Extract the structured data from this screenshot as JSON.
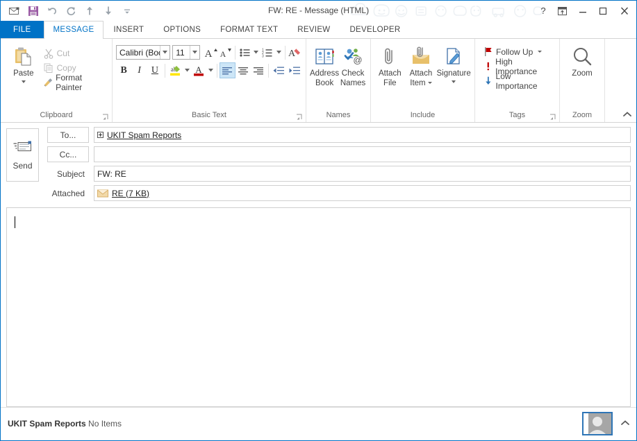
{
  "window": {
    "title": "FW: RE - Message (HTML)",
    "accent_color": "#0072c6",
    "quick_access": [
      {
        "name": "message-icon",
        "label": "Message"
      },
      {
        "name": "save-icon",
        "label": "Save"
      },
      {
        "name": "undo-icon",
        "label": "Undo"
      },
      {
        "name": "redo-icon",
        "label": "Redo"
      },
      {
        "name": "previous-item-icon",
        "label": "Previous Item"
      },
      {
        "name": "next-item-icon",
        "label": "Next Item"
      },
      {
        "name": "customize-qat-icon",
        "label": "Customize Quick Access Toolbar"
      }
    ],
    "controls": {
      "help": "?",
      "ribbon_display": "Ribbon Display Options",
      "minimize": "Minimize",
      "maximize": "Maximize",
      "close": "Close"
    }
  },
  "tabs": [
    {
      "label": "FILE",
      "state": "file"
    },
    {
      "label": "MESSAGE",
      "state": "active"
    },
    {
      "label": "INSERT",
      "state": "normal"
    },
    {
      "label": "OPTIONS",
      "state": "normal"
    },
    {
      "label": "FORMAT TEXT",
      "state": "normal"
    },
    {
      "label": "REVIEW",
      "state": "normal"
    },
    {
      "label": "DEVELOPER",
      "state": "normal"
    }
  ],
  "ribbon": {
    "clipboard": {
      "label": "Clipboard",
      "paste": "Paste",
      "cut": "Cut",
      "copy": "Copy",
      "format_painter": "Format Painter"
    },
    "basic_text": {
      "label": "Basic Text",
      "font_name": "Calibri (Bod",
      "font_size": "11",
      "grow_font": "Grow Font",
      "shrink_font": "Shrink Font",
      "bullets": "Bullets",
      "numbering": "Numbering",
      "clear_formatting": "Clear All Formatting",
      "bold": "B",
      "italic": "I",
      "underline": "U",
      "text_highlight": "Text Highlight Color",
      "font_color": "Font Color",
      "align_left": "Align Left",
      "align_center": "Center",
      "align_right": "Align Right",
      "decrease_indent": "Decrease Indent",
      "increase_indent": "Increase Indent"
    },
    "names": {
      "label": "Names",
      "address_book": "Address\nBook",
      "address_book_l1": "Address",
      "address_book_l2": "Book",
      "check_names_l1": "Check",
      "check_names_l2": "Names"
    },
    "include": {
      "label": "Include",
      "attach_file_l1": "Attach",
      "attach_file_l2": "File",
      "attach_item_l1": "Attach",
      "attach_item_l2": "Item",
      "signature": "Signature"
    },
    "tags": {
      "label": "Tags",
      "follow_up": "Follow Up",
      "high_importance": "High Importance",
      "low_importance": "Low Importance"
    },
    "zoom": {
      "label": "Zoom",
      "button": "Zoom"
    },
    "collapse_ribbon": "Collapse the Ribbon"
  },
  "compose": {
    "send_button": "Send",
    "to_button": "To...",
    "to_value": "UKIT Spam Reports",
    "cc_button": "Cc...",
    "cc_value": "",
    "subject_label": "Subject",
    "subject_value": "FW: RE",
    "attached_label": "Attached",
    "attachment_name": "RE (7 KB)",
    "body_value": ""
  },
  "status": {
    "account": "UKIT Spam Reports",
    "items": "No Items",
    "people_pane": "People Pane",
    "collapse": "Collapse"
  }
}
